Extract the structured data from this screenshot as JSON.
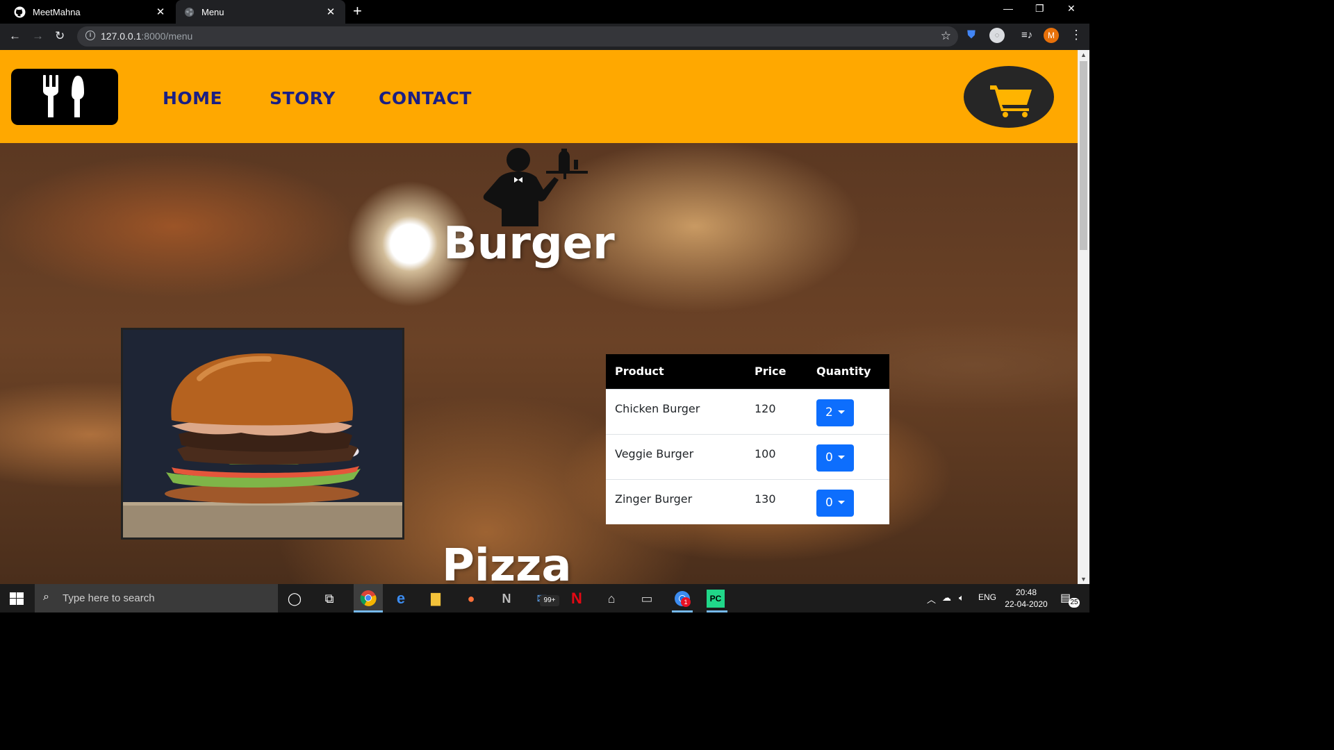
{
  "browser": {
    "tabs": [
      {
        "title": "MeetMahna",
        "icon": "github-icon"
      },
      {
        "title": "Menu",
        "icon": "globe-icon"
      }
    ],
    "url_host": "127.0.0.1",
    "url_path": ":8000/menu",
    "avatar_letter": "M"
  },
  "navbar": {
    "links": [
      "HOME",
      "STORY",
      "CONTACT"
    ],
    "accent_color": "#ffa800",
    "link_color": "#1a1f85"
  },
  "sections": [
    {
      "title": "Burger",
      "table": {
        "headers": [
          "Product",
          "Price",
          "Quantity"
        ],
        "rows": [
          {
            "product": "Chicken Burger",
            "price": "120",
            "quantity": "2"
          },
          {
            "product": "Veggie Burger",
            "price": "100",
            "quantity": "0"
          },
          {
            "product": "Zinger Burger",
            "price": "130",
            "quantity": "0"
          }
        ]
      }
    },
    {
      "title": "Pizza"
    }
  ],
  "taskbar": {
    "search_placeholder": "Type here to search",
    "mail_badge": "99+",
    "chrome_badge": "1",
    "language": "ENG",
    "time": "20:48",
    "date": "22-04-2020",
    "notification_count": "25"
  }
}
